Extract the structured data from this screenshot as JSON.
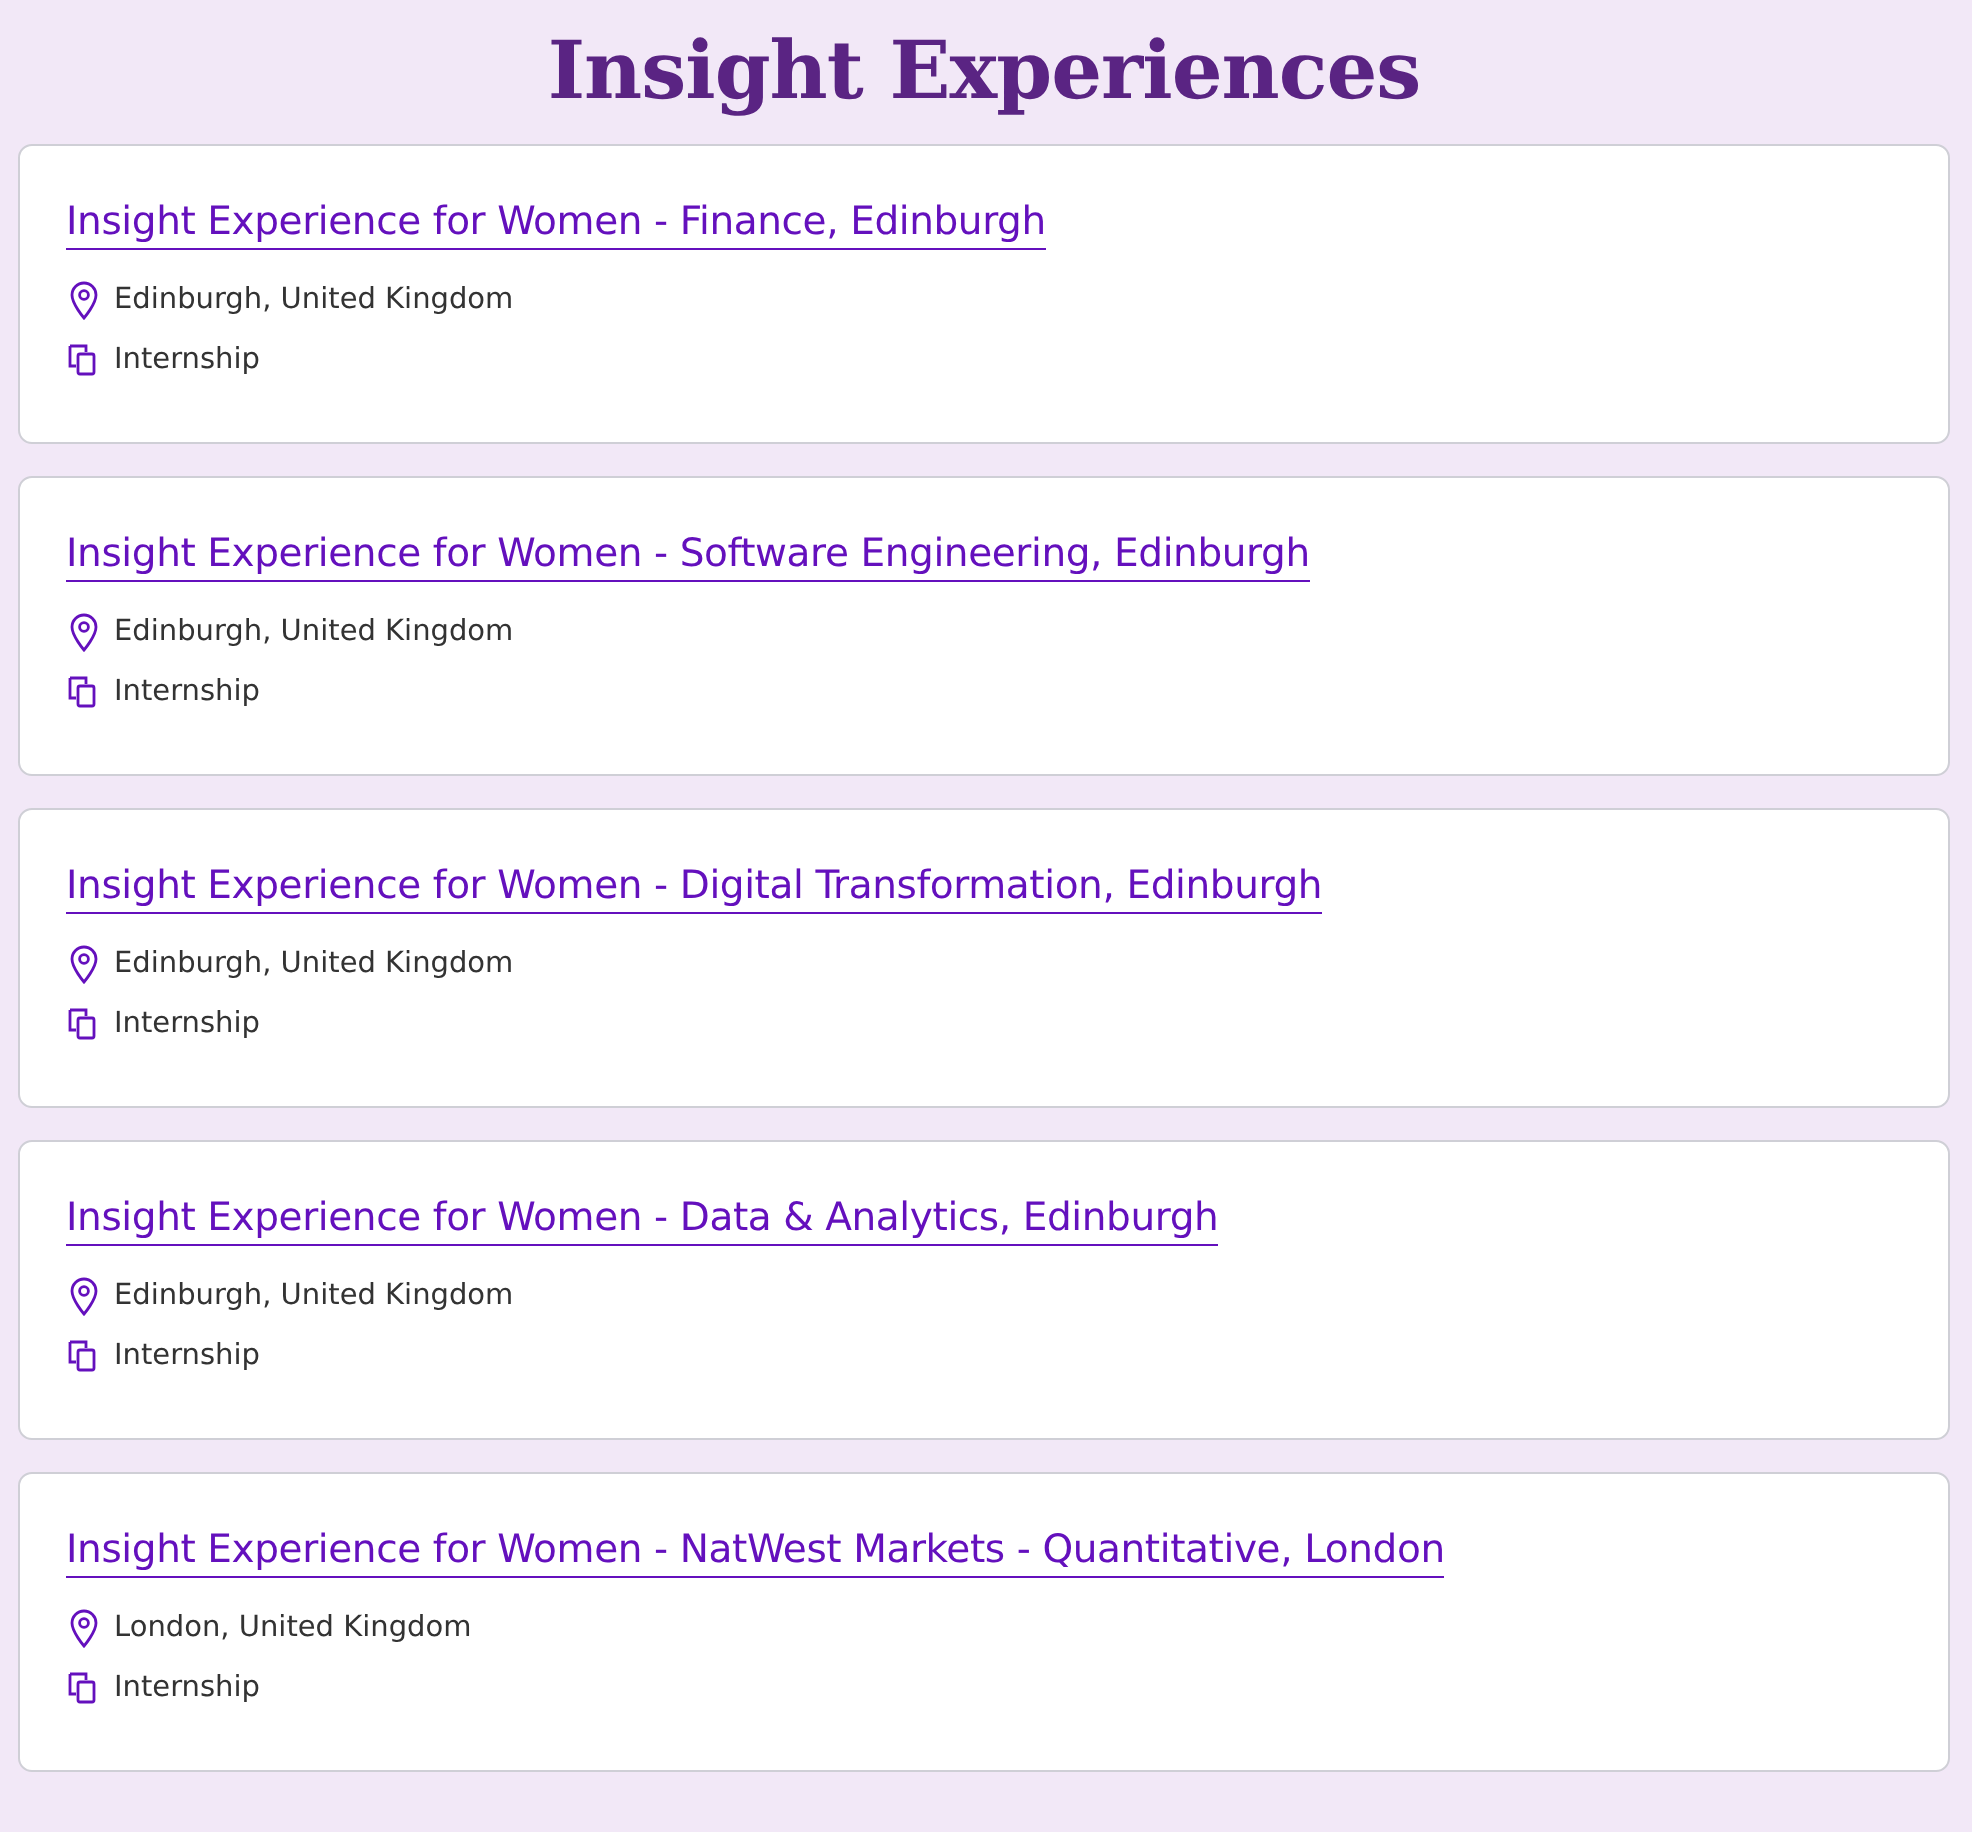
{
  "heading": "Insight Experiences",
  "jobs": [
    {
      "title": "Insight Experience for Women - Finance, Edinburgh",
      "location": "Edinburgh, United Kingdom",
      "type": "Internship"
    },
    {
      "title": "Insight Experience for Women - Software Engineering, Edinburgh",
      "location": "Edinburgh, United Kingdom",
      "type": "Internship"
    },
    {
      "title": "Insight Experience for Women - Digital Transformation, Edinburgh",
      "location": "Edinburgh, United Kingdom",
      "type": "Internship"
    },
    {
      "title": "Insight Experience for Women - Data & Analytics, Edinburgh",
      "location": "Edinburgh, United Kingdom",
      "type": "Internship"
    },
    {
      "title": "Insight Experience for Women - NatWest Markets - Quantitative, London",
      "location": "London, United Kingdom",
      "type": "Internship"
    }
  ]
}
